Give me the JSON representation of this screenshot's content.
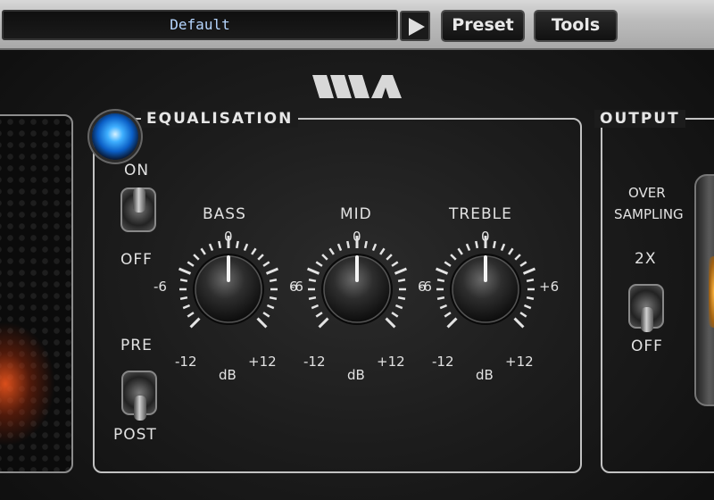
{
  "toolbar": {
    "preset_name": "Default",
    "next_icon": "play-triangle-icon",
    "preset_label": "Preset",
    "tools_label": "Tools"
  },
  "brand": {
    "logo_icon": "waves-wa-logo-icon"
  },
  "equalisation": {
    "title": "EQUALISATION",
    "power_led": "on",
    "power_switch": {
      "on_label": "ON",
      "off_label": "OFF",
      "value": "ON"
    },
    "position_switch": {
      "pre_label": "PRE",
      "post_label": "POST",
      "value": "POST"
    },
    "knobs": [
      {
        "label": "BASS",
        "zero": "0",
        "left_mid": "-6",
        "right_mid": "6",
        "min": "-12",
        "max": "+12",
        "unit": "dB",
        "value_db": 0
      },
      {
        "label": "MID",
        "zero": "0",
        "left_mid": "-6",
        "right_mid": "6",
        "min": "-12",
        "max": "+12",
        "unit": "dB",
        "value_db": 0
      },
      {
        "label": "TREBLE",
        "zero": "0",
        "left_mid": "-6",
        "right_mid": "+6",
        "min": "-12",
        "max": "+12",
        "unit": "dB",
        "value_db": 0
      }
    ]
  },
  "output": {
    "title": "OUTPUT",
    "oversampling_line1": "OVER",
    "oversampling_line2": "SAMPLING",
    "oversampling_on_label": "2X",
    "oversampling_off_label": "OFF",
    "oversampling_value": "OFF"
  },
  "colors": {
    "led_blue": "#3fb0ff",
    "display_text": "#b6d6ff",
    "panel_line": "#c2c2c2"
  }
}
